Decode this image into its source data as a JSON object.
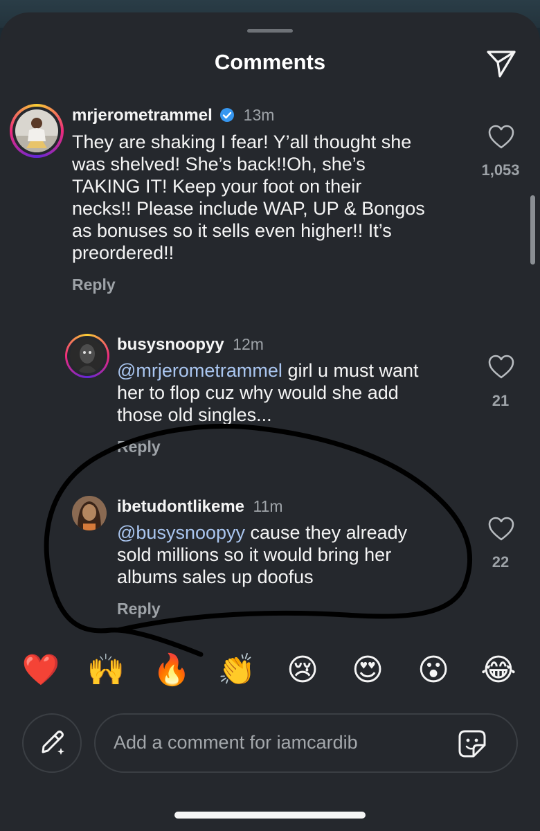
{
  "header": {
    "title": "Comments",
    "share_icon": "paper-plane-icon"
  },
  "comments": [
    {
      "username": "mrjerometrammel",
      "verified": true,
      "time": "13m",
      "text_lines": [
        "They are shaking I fear! Y’all thought she",
        "was shelved! She’s back!!Oh, she’s",
        "TAKING IT! Keep your foot on their",
        "necks!! Please include WAP, UP & Bongos",
        "as bonuses so it sells even higher!! It’s",
        "preordered!!"
      ],
      "reply_label": "Reply",
      "like_count": "1,053"
    },
    {
      "username": "busysnoopyy",
      "time": "12m",
      "mention": "@mrjerometrammel",
      "line1_rest": " girl u must want",
      "text_lines": [
        "her to flop cuz why would she add",
        "those old singles..."
      ],
      "reply_label": "Reply",
      "like_count": "21"
    },
    {
      "username": "ibetudontlikeme",
      "time": "11m",
      "mention": "@busysnoopyy",
      "line1_rest": " cause they already",
      "text_lines": [
        "sold millions so it would bring her",
        "albums sales up doofus"
      ],
      "reply_label": "Reply",
      "like_count": "22"
    }
  ],
  "emoji_bar": [
    "❤️",
    "🙌",
    "🔥",
    "👏",
    "😢",
    "😍",
    "😮",
    "😂"
  ],
  "composer": {
    "placeholder": "Add a comment for iamcardib",
    "edit_icon": "pencil-sparkle-icon",
    "sticker_icon": "sticker-icon"
  },
  "colors": {
    "background": "#25282d",
    "mention": "#aac6f0",
    "muted": "#9ea3a8",
    "verified": "#3797f0"
  }
}
